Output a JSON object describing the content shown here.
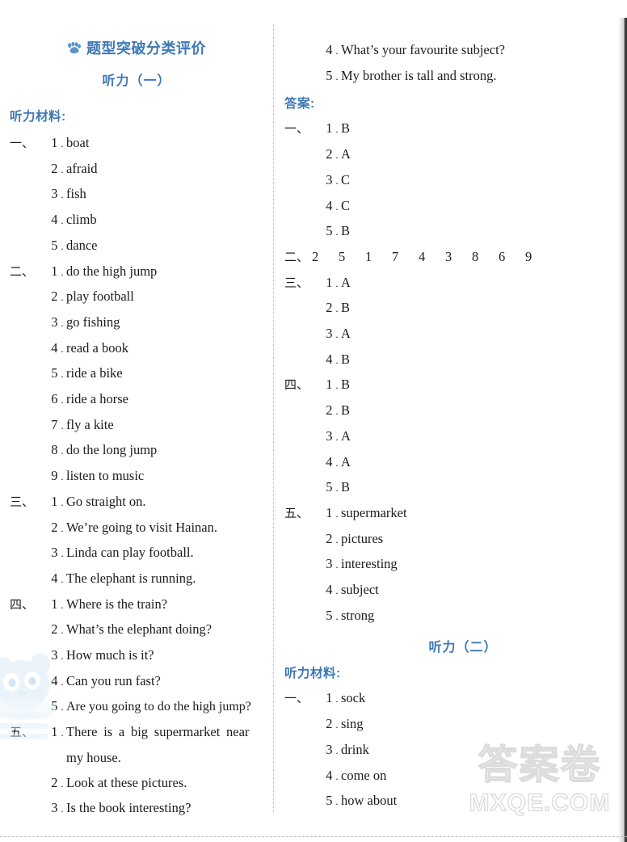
{
  "page": {
    "title": "题型突破分类评价",
    "title_icon": "paw-icon",
    "accent_color": "#3f78b4",
    "text_color": "#1c1c1c",
    "watermark_cn": "答案卷",
    "watermark_en": "MXQE.COM"
  },
  "left_column": {
    "subtitle": "听力（一）",
    "materials_label": "听力材料:",
    "sections": [
      {
        "marker": "一、",
        "items": [
          {
            "num": "1",
            "text": "boat"
          },
          {
            "num": "2",
            "text": "afraid"
          },
          {
            "num": "3",
            "text": "fish"
          },
          {
            "num": "4",
            "text": "climb"
          },
          {
            "num": "5",
            "text": "dance"
          }
        ]
      },
      {
        "marker": "二、",
        "items": [
          {
            "num": "1",
            "text": "do the high jump"
          },
          {
            "num": "2",
            "text": "play football"
          },
          {
            "num": "3",
            "text": "go fishing"
          },
          {
            "num": "4",
            "text": "read a book"
          },
          {
            "num": "5",
            "text": "ride a bike"
          },
          {
            "num": "6",
            "text": "ride a horse"
          },
          {
            "num": "7",
            "text": "fly a kite"
          },
          {
            "num": "8",
            "text": "do the long jump"
          },
          {
            "num": "9",
            "text": "listen to music"
          }
        ]
      },
      {
        "marker": "三、",
        "items": [
          {
            "num": "1",
            "text": "Go straight on."
          },
          {
            "num": "2",
            "text": "We’re going to visit Hainan."
          },
          {
            "num": "3",
            "text": "Linda can play football."
          },
          {
            "num": "4",
            "text": "The elephant is running."
          }
        ]
      },
      {
        "marker": "四、",
        "items": [
          {
            "num": "1",
            "text": "Where is the train?"
          },
          {
            "num": "2",
            "text": "What’s the elephant doing?"
          },
          {
            "num": "3",
            "text": "How much is it?"
          },
          {
            "num": "4",
            "text": "Can you run fast?"
          },
          {
            "num": "5",
            "text": "Are you going to do the high jump?"
          }
        ]
      },
      {
        "marker": "五、",
        "items": [
          {
            "num": "1",
            "text": "There is a big supermarket near",
            "cont": "my house."
          },
          {
            "num": "2",
            "text": "Look at these pictures."
          },
          {
            "num": "3",
            "text": "Is the book interesting?"
          }
        ]
      }
    ]
  },
  "right_column": {
    "continued_items": [
      {
        "num": "4",
        "text": "What’s your favourite subject?"
      },
      {
        "num": "5",
        "text": "My brother is tall and strong."
      }
    ],
    "answers_label": "答案:",
    "answer_sections": [
      {
        "marker": "一、",
        "items": [
          {
            "num": "1",
            "text": "B"
          },
          {
            "num": "2",
            "text": "A"
          },
          {
            "num": "3",
            "text": "C"
          },
          {
            "num": "4",
            "text": "C"
          },
          {
            "num": "5",
            "text": "B"
          }
        ]
      },
      {
        "marker": "二、",
        "sequence": [
          "2",
          "5",
          "1",
          "7",
          "4",
          "3",
          "8",
          "6",
          "9"
        ]
      },
      {
        "marker": "三、",
        "items": [
          {
            "num": "1",
            "text": "A"
          },
          {
            "num": "2",
            "text": "B"
          },
          {
            "num": "3",
            "text": "A"
          },
          {
            "num": "4",
            "text": "B"
          }
        ]
      },
      {
        "marker": "四、",
        "items": [
          {
            "num": "1",
            "text": "B"
          },
          {
            "num": "2",
            "text": "B"
          },
          {
            "num": "3",
            "text": "A"
          },
          {
            "num": "4",
            "text": "A"
          },
          {
            "num": "5",
            "text": "B"
          }
        ]
      },
      {
        "marker": "五、",
        "items": [
          {
            "num": "1",
            "text": "supermarket"
          },
          {
            "num": "2",
            "text": "pictures"
          },
          {
            "num": "3",
            "text": "interesting"
          },
          {
            "num": "4",
            "text": "subject"
          },
          {
            "num": "5",
            "text": "strong"
          }
        ]
      }
    ],
    "subtitle2": "听力（二）",
    "materials_label2": "听力材料:",
    "sections2": [
      {
        "marker": "一、",
        "items": [
          {
            "num": "1",
            "text": "sock"
          },
          {
            "num": "2",
            "text": "sing"
          },
          {
            "num": "3",
            "text": "drink"
          },
          {
            "num": "4",
            "text": "come on"
          },
          {
            "num": "5",
            "text": "how about"
          }
        ]
      }
    ]
  }
}
